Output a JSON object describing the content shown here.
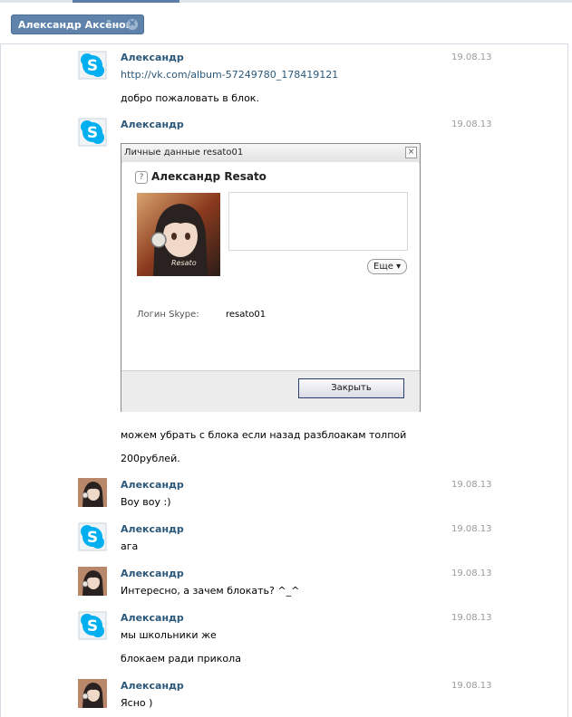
{
  "tab": {
    "label": "Александр Аксёнов",
    "close_icon": "close-icon"
  },
  "messages": [
    {
      "author": "Александр",
      "date": "19.08.13",
      "avatar": "skype-avatar",
      "lines": [
        "http://vk.com/album-57249780_178419121",
        "добро пожаловать в блок."
      ]
    },
    {
      "author": "Александр",
      "date": "19.08.13",
      "avatar": "skype-avatar",
      "lines": [
        "можем убрать с блока если назад разблоакам толпой",
        "200рублей."
      ]
    },
    {
      "author": "Александр",
      "date": "19.08.13",
      "avatar": "anime-avatar",
      "lines": [
        "Воу воу :)"
      ]
    },
    {
      "author": "Александр",
      "date": "19.08.13",
      "avatar": "skype-avatar",
      "lines": [
        "ага"
      ]
    },
    {
      "author": "Александр",
      "date": "19.08.13",
      "avatar": "anime-avatar",
      "lines": [
        "Интересно, а зачем блокать? ^_^"
      ]
    },
    {
      "author": "Александр",
      "date": "19.08.13",
      "avatar": "skype-avatar",
      "lines": [
        "мы школьники же",
        "блокаем ради прикола"
      ]
    },
    {
      "author": "Александр",
      "date": "19.08.13",
      "avatar": "anime-avatar",
      "lines": [
        "Ясно )"
      ]
    }
  ],
  "dialog": {
    "title": "Личные данные resato01",
    "name": "Александр Resato",
    "more_label": "Еще",
    "login_label": "Логин Skype:",
    "login_value": "resato01",
    "close_label": "Закрыть",
    "image_text": "Resato"
  },
  "colors": {
    "accent": "#2b587a",
    "tab": "#5f83ab",
    "skype": "#00aff0"
  }
}
